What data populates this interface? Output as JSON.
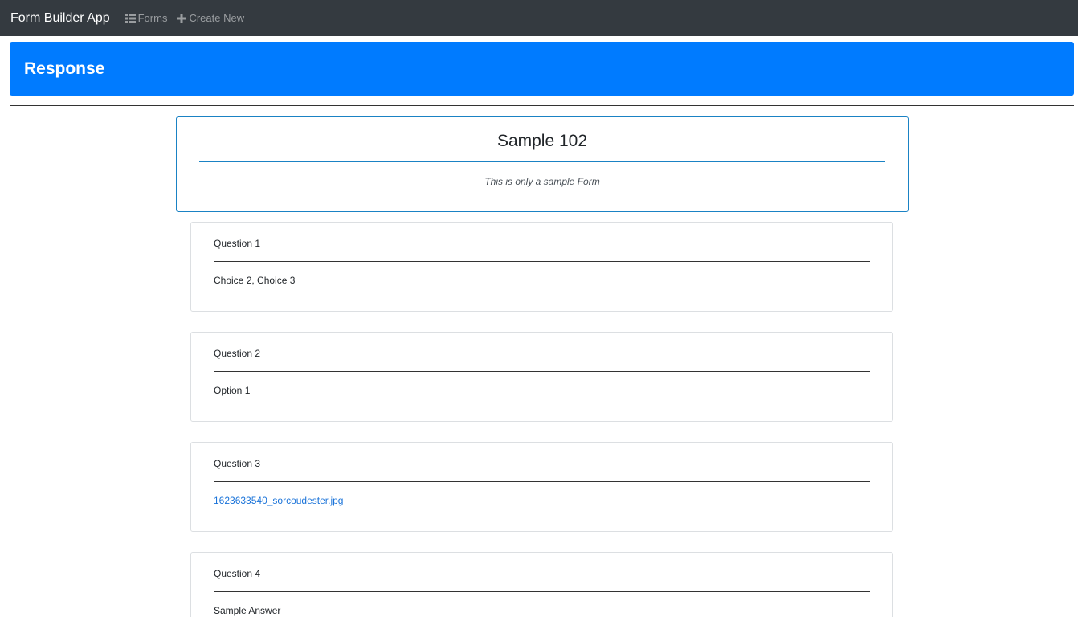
{
  "navbar": {
    "brand": "Form Builder App",
    "links": [
      {
        "label": "Forms",
        "icon": "table-icon"
      },
      {
        "label": "Create New",
        "icon": "plus-icon"
      }
    ]
  },
  "header": {
    "title": "Response"
  },
  "form": {
    "title": "Sample 102",
    "description": "This is only a sample Form"
  },
  "questions": [
    {
      "label": "Question 1",
      "answer": "Choice 2, Choice 3"
    },
    {
      "label": "Question 2",
      "answer": "Option 1"
    },
    {
      "label": "Question 3",
      "answer": "1623633540_sorcoudester.jpg",
      "is_link": true
    },
    {
      "label": "Question 4",
      "answer": "Sample Answer"
    }
  ],
  "colors": {
    "navbar": "#343a40",
    "header": "#007bff",
    "link": "#1a73d9",
    "form_border": "#1a82c4"
  }
}
